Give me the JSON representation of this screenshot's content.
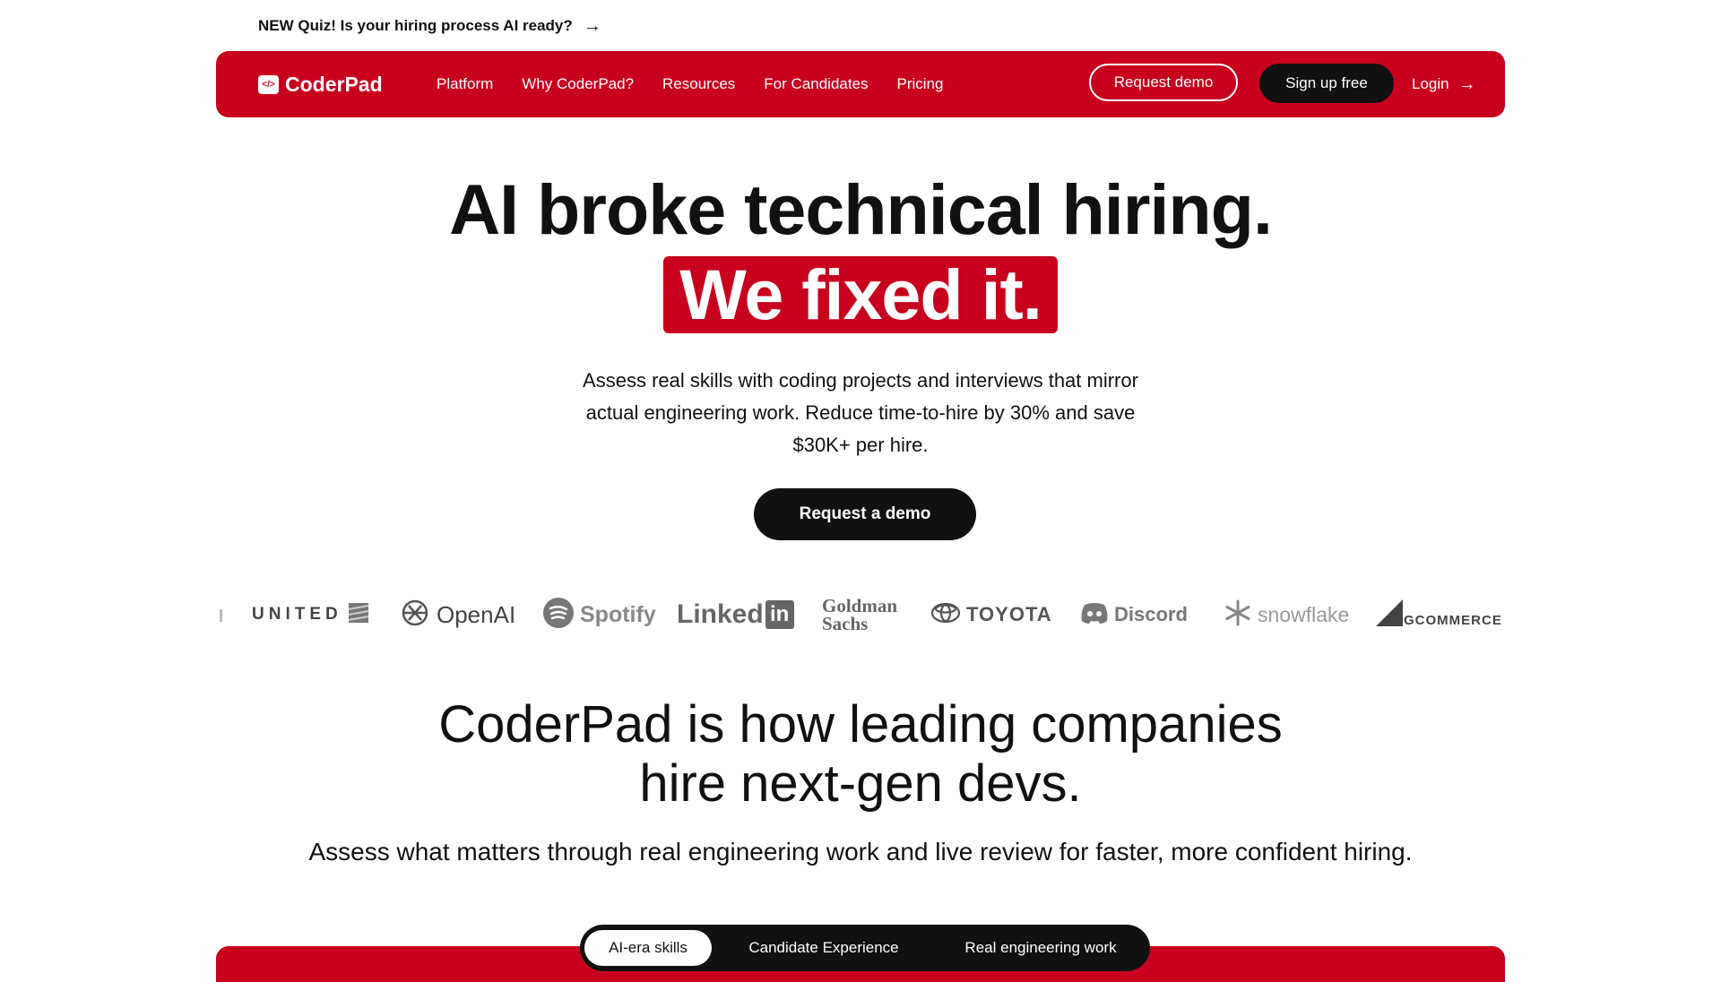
{
  "announcement": {
    "text": "NEW Quiz! Is your hiring process AI ready?",
    "arrow": "→"
  },
  "nav": {
    "logo_icon": "</>",
    "logo_text": "CoderPad",
    "links": [
      "Platform",
      "Why CoderPad?",
      "Resources",
      "For Candidates",
      "Pricing"
    ],
    "request_demo": "Request demo",
    "signup": "Sign up free",
    "login": "Login",
    "login_arrow": "→"
  },
  "hero": {
    "line1": "AI broke technical hiring.",
    "line2": "We fixed it.",
    "sub": "Assess real skills with coding projects and interviews that mirror actual engineering work. Reduce time-to-hire by 30% and save $30K+ per hire.",
    "cta": "Request a demo"
  },
  "logos": [
    {
      "name": "UNITED"
    },
    {
      "name": "OpenAI"
    },
    {
      "name": "Spotify"
    },
    {
      "name": "Linked"
    },
    {
      "name": "Goldman Sachs"
    },
    {
      "name": "TOYOTA"
    },
    {
      "name": "Discord"
    },
    {
      "name": "snowflake"
    },
    {
      "name": "BIGCOMMERCE"
    }
  ],
  "section": {
    "title_line1": "CoderPad is how leading companies",
    "title_line2": "hire next-gen devs.",
    "sub": "Assess what matters through real engineering work and live review for faster, more confident hiring."
  },
  "tabs": [
    "AI-era skills",
    "Candidate Experience",
    "Real engineering work"
  ],
  "colors": {
    "brand": "#c8001e",
    "dark": "#111111",
    "logo_gray": "#666666"
  }
}
